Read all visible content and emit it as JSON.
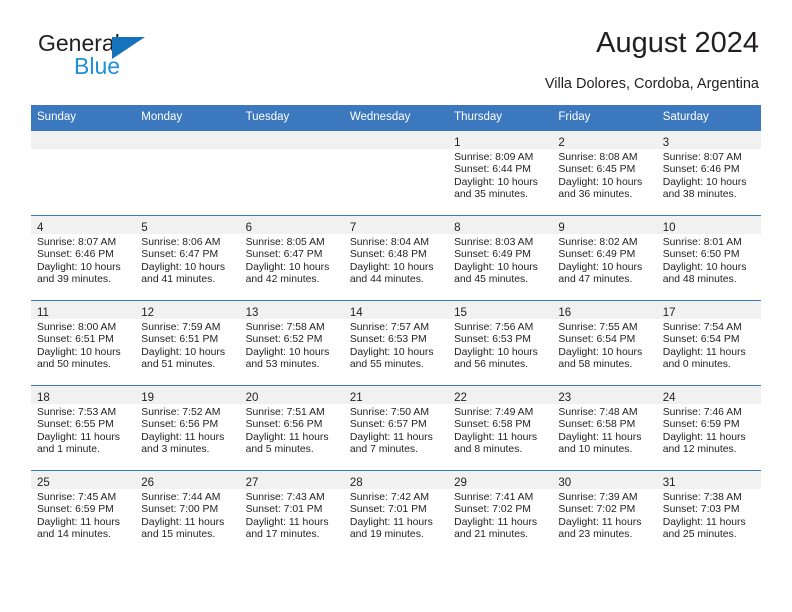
{
  "brand": {
    "name_top": "General",
    "name_bottom": "Blue",
    "accent_color": "#1573bb",
    "blue_text_color": "#1f8fd6"
  },
  "header": {
    "title": "August 2024",
    "subtitle": "Villa Dolores, Cordoba, Argentina"
  },
  "calendar": {
    "header_bg": "#3b78bd",
    "header_text_color": "#ffffff",
    "daynum_bg": "#f1f1f1",
    "weekdays": [
      "Sunday",
      "Monday",
      "Tuesday",
      "Wednesday",
      "Thursday",
      "Friday",
      "Saturday"
    ],
    "weeks": [
      [
        {
          "day": "",
          "sunrise": "",
          "sunset": "",
          "daylight_line1": "",
          "daylight_line2": ""
        },
        {
          "day": "",
          "sunrise": "",
          "sunset": "",
          "daylight_line1": "",
          "daylight_line2": ""
        },
        {
          "day": "",
          "sunrise": "",
          "sunset": "",
          "daylight_line1": "",
          "daylight_line2": ""
        },
        {
          "day": "",
          "sunrise": "",
          "sunset": "",
          "daylight_line1": "",
          "daylight_line2": ""
        },
        {
          "day": "1",
          "sunrise": "Sunrise: 8:09 AM",
          "sunset": "Sunset: 6:44 PM",
          "daylight_line1": "Daylight: 10 hours",
          "daylight_line2": "and 35 minutes."
        },
        {
          "day": "2",
          "sunrise": "Sunrise: 8:08 AM",
          "sunset": "Sunset: 6:45 PM",
          "daylight_line1": "Daylight: 10 hours",
          "daylight_line2": "and 36 minutes."
        },
        {
          "day": "3",
          "sunrise": "Sunrise: 8:07 AM",
          "sunset": "Sunset: 6:46 PM",
          "daylight_line1": "Daylight: 10 hours",
          "daylight_line2": "and 38 minutes."
        }
      ],
      [
        {
          "day": "4",
          "sunrise": "Sunrise: 8:07 AM",
          "sunset": "Sunset: 6:46 PM",
          "daylight_line1": "Daylight: 10 hours",
          "daylight_line2": "and 39 minutes."
        },
        {
          "day": "5",
          "sunrise": "Sunrise: 8:06 AM",
          "sunset": "Sunset: 6:47 PM",
          "daylight_line1": "Daylight: 10 hours",
          "daylight_line2": "and 41 minutes."
        },
        {
          "day": "6",
          "sunrise": "Sunrise: 8:05 AM",
          "sunset": "Sunset: 6:47 PM",
          "daylight_line1": "Daylight: 10 hours",
          "daylight_line2": "and 42 minutes."
        },
        {
          "day": "7",
          "sunrise": "Sunrise: 8:04 AM",
          "sunset": "Sunset: 6:48 PM",
          "daylight_line1": "Daylight: 10 hours",
          "daylight_line2": "and 44 minutes."
        },
        {
          "day": "8",
          "sunrise": "Sunrise: 8:03 AM",
          "sunset": "Sunset: 6:49 PM",
          "daylight_line1": "Daylight: 10 hours",
          "daylight_line2": "and 45 minutes."
        },
        {
          "day": "9",
          "sunrise": "Sunrise: 8:02 AM",
          "sunset": "Sunset: 6:49 PM",
          "daylight_line1": "Daylight: 10 hours",
          "daylight_line2": "and 47 minutes."
        },
        {
          "day": "10",
          "sunrise": "Sunrise: 8:01 AM",
          "sunset": "Sunset: 6:50 PM",
          "daylight_line1": "Daylight: 10 hours",
          "daylight_line2": "and 48 minutes."
        }
      ],
      [
        {
          "day": "11",
          "sunrise": "Sunrise: 8:00 AM",
          "sunset": "Sunset: 6:51 PM",
          "daylight_line1": "Daylight: 10 hours",
          "daylight_line2": "and 50 minutes."
        },
        {
          "day": "12",
          "sunrise": "Sunrise: 7:59 AM",
          "sunset": "Sunset: 6:51 PM",
          "daylight_line1": "Daylight: 10 hours",
          "daylight_line2": "and 51 minutes."
        },
        {
          "day": "13",
          "sunrise": "Sunrise: 7:58 AM",
          "sunset": "Sunset: 6:52 PM",
          "daylight_line1": "Daylight: 10 hours",
          "daylight_line2": "and 53 minutes."
        },
        {
          "day": "14",
          "sunrise": "Sunrise: 7:57 AM",
          "sunset": "Sunset: 6:53 PM",
          "daylight_line1": "Daylight: 10 hours",
          "daylight_line2": "and 55 minutes."
        },
        {
          "day": "15",
          "sunrise": "Sunrise: 7:56 AM",
          "sunset": "Sunset: 6:53 PM",
          "daylight_line1": "Daylight: 10 hours",
          "daylight_line2": "and 56 minutes."
        },
        {
          "day": "16",
          "sunrise": "Sunrise: 7:55 AM",
          "sunset": "Sunset: 6:54 PM",
          "daylight_line1": "Daylight: 10 hours",
          "daylight_line2": "and 58 minutes."
        },
        {
          "day": "17",
          "sunrise": "Sunrise: 7:54 AM",
          "sunset": "Sunset: 6:54 PM",
          "daylight_line1": "Daylight: 11 hours",
          "daylight_line2": "and 0 minutes."
        }
      ],
      [
        {
          "day": "18",
          "sunrise": "Sunrise: 7:53 AM",
          "sunset": "Sunset: 6:55 PM",
          "daylight_line1": "Daylight: 11 hours",
          "daylight_line2": "and 1 minute."
        },
        {
          "day": "19",
          "sunrise": "Sunrise: 7:52 AM",
          "sunset": "Sunset: 6:56 PM",
          "daylight_line1": "Daylight: 11 hours",
          "daylight_line2": "and 3 minutes."
        },
        {
          "day": "20",
          "sunrise": "Sunrise: 7:51 AM",
          "sunset": "Sunset: 6:56 PM",
          "daylight_line1": "Daylight: 11 hours",
          "daylight_line2": "and 5 minutes."
        },
        {
          "day": "21",
          "sunrise": "Sunrise: 7:50 AM",
          "sunset": "Sunset: 6:57 PM",
          "daylight_line1": "Daylight: 11 hours",
          "daylight_line2": "and 7 minutes."
        },
        {
          "day": "22",
          "sunrise": "Sunrise: 7:49 AM",
          "sunset": "Sunset: 6:58 PM",
          "daylight_line1": "Daylight: 11 hours",
          "daylight_line2": "and 8 minutes."
        },
        {
          "day": "23",
          "sunrise": "Sunrise: 7:48 AM",
          "sunset": "Sunset: 6:58 PM",
          "daylight_line1": "Daylight: 11 hours",
          "daylight_line2": "and 10 minutes."
        },
        {
          "day": "24",
          "sunrise": "Sunrise: 7:46 AM",
          "sunset": "Sunset: 6:59 PM",
          "daylight_line1": "Daylight: 11 hours",
          "daylight_line2": "and 12 minutes."
        }
      ],
      [
        {
          "day": "25",
          "sunrise": "Sunrise: 7:45 AM",
          "sunset": "Sunset: 6:59 PM",
          "daylight_line1": "Daylight: 11 hours",
          "daylight_line2": "and 14 minutes."
        },
        {
          "day": "26",
          "sunrise": "Sunrise: 7:44 AM",
          "sunset": "Sunset: 7:00 PM",
          "daylight_line1": "Daylight: 11 hours",
          "daylight_line2": "and 15 minutes."
        },
        {
          "day": "27",
          "sunrise": "Sunrise: 7:43 AM",
          "sunset": "Sunset: 7:01 PM",
          "daylight_line1": "Daylight: 11 hours",
          "daylight_line2": "and 17 minutes."
        },
        {
          "day": "28",
          "sunrise": "Sunrise: 7:42 AM",
          "sunset": "Sunset: 7:01 PM",
          "daylight_line1": "Daylight: 11 hours",
          "daylight_line2": "and 19 minutes."
        },
        {
          "day": "29",
          "sunrise": "Sunrise: 7:41 AM",
          "sunset": "Sunset: 7:02 PM",
          "daylight_line1": "Daylight: 11 hours",
          "daylight_line2": "and 21 minutes."
        },
        {
          "day": "30",
          "sunrise": "Sunrise: 7:39 AM",
          "sunset": "Sunset: 7:02 PM",
          "daylight_line1": "Daylight: 11 hours",
          "daylight_line2": "and 23 minutes."
        },
        {
          "day": "31",
          "sunrise": "Sunrise: 7:38 AM",
          "sunset": "Sunset: 7:03 PM",
          "daylight_line1": "Daylight: 11 hours",
          "daylight_line2": "and 25 minutes."
        }
      ]
    ]
  }
}
